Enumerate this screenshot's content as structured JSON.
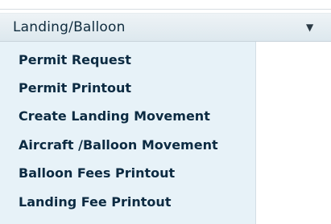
{
  "dropdown": {
    "selected_label": "Landing/Balloon",
    "caret_icon": "chevron-down-icon"
  },
  "menu": {
    "items": [
      {
        "label": "Permit Request"
      },
      {
        "label": "Permit Printout"
      },
      {
        "label": "Create Landing Movement"
      },
      {
        "label": "Aircraft /Balloon Movement"
      },
      {
        "label": "Balloon Fees Printout"
      },
      {
        "label": "Landing Fee Printout"
      }
    ]
  }
}
